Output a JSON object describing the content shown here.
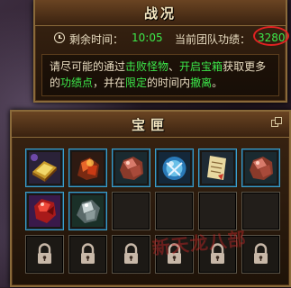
{
  "status_panel": {
    "title": "战况",
    "time_label": "剩余时间：",
    "time_value": "10:05",
    "score_label": "当前团队功绩：",
    "score_value": "3280",
    "desc": {
      "p1": "请尽可能的通过",
      "h1": "击败怪物",
      "p2": "、",
      "h2": "开启宝箱",
      "p3": "获取更多的",
      "h3": "功绩点",
      "p4": "，并在",
      "h4": "限定",
      "p5": "的时间内",
      "h5": "撤离",
      "p6": "。"
    }
  },
  "box_panel": {
    "title": "宝匣",
    "watermark": "新天龙八部",
    "slots": [
      {
        "state": "filled",
        "icon": "gold-ingot-icon"
      },
      {
        "state": "filled",
        "icon": "fire-ore-icon"
      },
      {
        "state": "filled",
        "icon": "copper-ore-icon"
      },
      {
        "state": "filled",
        "icon": "crystal-orb-icon"
      },
      {
        "state": "filled",
        "icon": "scroll-icon"
      },
      {
        "state": "filled",
        "icon": "copper-ore-icon"
      },
      {
        "state": "filled",
        "icon": "red-gem-icon"
      },
      {
        "state": "filled",
        "icon": "silver-ore-icon"
      },
      {
        "state": "empty"
      },
      {
        "state": "empty"
      },
      {
        "state": "empty"
      },
      {
        "state": "empty"
      },
      {
        "state": "locked",
        "icon": "lock-icon"
      },
      {
        "state": "locked",
        "icon": "lock-icon"
      },
      {
        "state": "locked",
        "icon": "lock-icon"
      },
      {
        "state": "locked",
        "icon": "lock-icon"
      },
      {
        "state": "locked",
        "icon": "lock-icon"
      },
      {
        "state": "locked",
        "icon": "lock-icon"
      }
    ]
  },
  "colors": {
    "highlight_green": "#3ce84a",
    "score_circle_red": "#e02222",
    "slot_border_blue": "#3c9ec8",
    "panel_gold_border": "#8a6a3a"
  }
}
